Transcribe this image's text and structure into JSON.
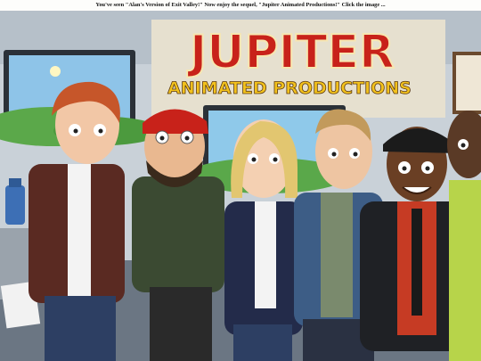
{
  "banner": {
    "text": "You've seen \"Alan's Version of Exit Valley!\" Now enjoy the sequel, \"Jupiter Animated Productions!\" Click the image ..."
  },
  "poster": {
    "title_line1": "JUPITER",
    "title_line2": "ANIMATED PRODUCTIONS",
    "colors": {
      "title_red": "#c8221a",
      "title_yellow": "#f3c21c",
      "wall": "#cfd6dc",
      "desk": "#6b7683"
    }
  }
}
